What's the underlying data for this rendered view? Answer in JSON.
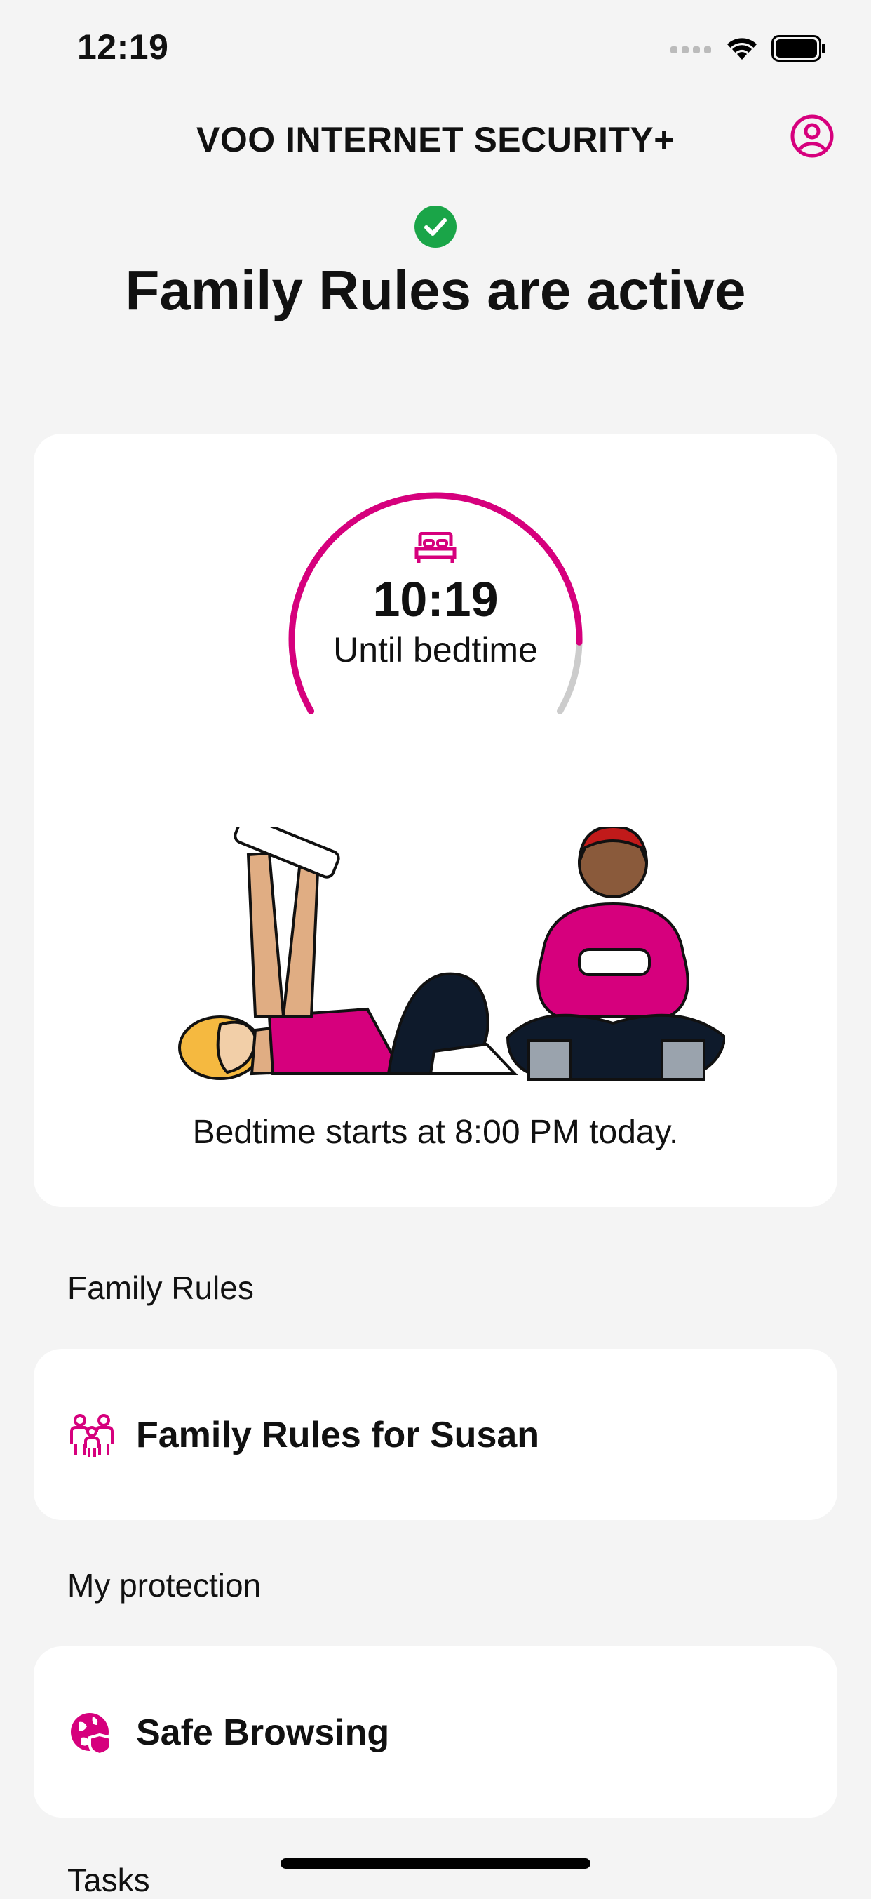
{
  "status_bar": {
    "time": "12:19",
    "icons": [
      "signal-icon",
      "wifi-icon",
      "battery-icon"
    ]
  },
  "header": {
    "title": "VOO INTERNET SECURITY+",
    "profile_icon": "profile-icon"
  },
  "hero": {
    "status_icon": "check-circle-icon",
    "title": "Family Rules are active"
  },
  "timer_card": {
    "icon": "bed-icon",
    "time_remaining": "10:19",
    "label": "Until bedtime",
    "progress_fraction": 0.88,
    "note": "Bedtime starts at 8:00 PM today."
  },
  "sections": {
    "family_rules_label": "Family Rules",
    "family_rules_item": "Family Rules for Susan",
    "family_rules_icon": "family-icon",
    "protection_label": "My protection",
    "safe_browsing_item": "Safe Browsing",
    "safe_browsing_icon": "globe-shield-icon",
    "tasks_label": "Tasks"
  },
  "colors": {
    "accent": "#d6007d",
    "success": "#1aa548",
    "track": "#cccccc",
    "background": "#f4f4f4",
    "card": "#ffffff"
  }
}
